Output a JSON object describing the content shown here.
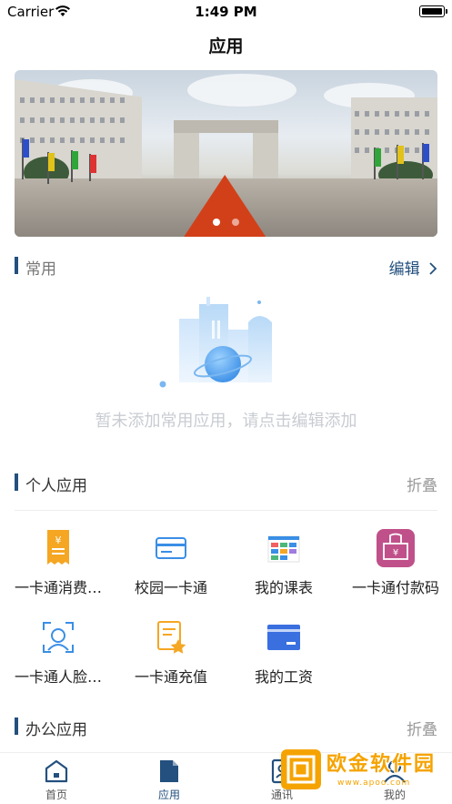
{
  "status_bar": {
    "carrier": "Carrier",
    "time": "1:49 PM"
  },
  "nav": {
    "title": "应用"
  },
  "banner": {
    "slides": 2,
    "active_slide": 1
  },
  "common_section": {
    "title": "常用",
    "action": "编辑",
    "empty_text": "暂未添加常用应用，请点击编辑添加"
  },
  "personal_section": {
    "title": "个人应用",
    "action": "折叠",
    "apps": [
      {
        "label": "一卡通消费…",
        "icon": "receipt-yen-icon",
        "color": "#f5a623"
      },
      {
        "label": "校园一卡通",
        "icon": "card-icon",
        "color": "#3a8ee6"
      },
      {
        "label": "我的课表",
        "icon": "timetable-icon",
        "color": "#3a8ee6"
      },
      {
        "label": "一卡通付款码",
        "icon": "payment-code-icon",
        "color": "#c0508a"
      },
      {
        "label": "一卡通人脸…",
        "icon": "face-scan-icon",
        "color": "#3a8ee6"
      },
      {
        "label": "一卡通充值",
        "icon": "recharge-star-icon",
        "color": "#f5a623"
      },
      {
        "label": "我的工资",
        "icon": "salary-card-icon",
        "color": "#3a6fe0"
      }
    ]
  },
  "office_section": {
    "title": "办公应用",
    "action": "折叠"
  },
  "tabbar": {
    "tabs": [
      {
        "label": "首页",
        "icon": "home-icon"
      },
      {
        "label": "应用",
        "icon": "apps-document-icon"
      },
      {
        "label": "通讯",
        "icon": "contacts-icon"
      },
      {
        "label": "我的",
        "icon": "profile-icon"
      }
    ],
    "active_index": 1
  },
  "watermark": {
    "text_cn": "欧金软件园",
    "text_en": "www.apoo.com"
  }
}
